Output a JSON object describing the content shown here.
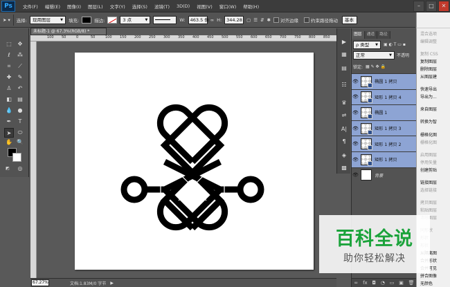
{
  "app": {
    "logo": "Ps"
  },
  "menu": [
    "文件(F)",
    "编辑(E)",
    "图像(I)",
    "图层(L)",
    "文字(Y)",
    "选择(S)",
    "滤镜(T)",
    "3D(D)",
    "视图(V)",
    "窗口(W)",
    "帮助(H)"
  ],
  "window_buttons": [
    "–",
    "□",
    "✕"
  ],
  "options": {
    "select_label": "选择:",
    "select_value": "现用图层",
    "fill_label": "填充:",
    "stroke_label": "描边:",
    "stroke_width": "3 点",
    "width_label": "W:",
    "width_value": "463.5 像",
    "height_label": "H:",
    "height_value": "344.28",
    "align_edges": "对齐边缘",
    "constrain": "约束路径拖动",
    "workspace": "基本"
  },
  "document": {
    "tab_title": "未标题-1 @ 67.3%(RGB/8) *",
    "ruler_ticks": [
      "100",
      "50",
      "0",
      "50",
      "100",
      "150",
      "200",
      "250",
      "300",
      "350",
      "400",
      "450",
      "500",
      "550",
      "600",
      "650",
      "700",
      "750",
      "800",
      "850"
    ]
  },
  "status": {
    "zoom": "67.27%",
    "doc_info": "文档:1.83M/0 字节"
  },
  "layers_panel": {
    "tabs": [
      "图层",
      "通道",
      "路径"
    ],
    "filter_label": "ρ 类型",
    "blend_mode": "正常",
    "opacity_label": "不透明",
    "lock_label": "锁定:",
    "layers": [
      {
        "name": "椭圆 1 拷贝",
        "selected": true
      },
      {
        "name": "矩形 1 拷贝 4",
        "selected": true
      },
      {
        "name": "椭圆 1",
        "selected": true
      },
      {
        "name": "矩形 1 拷贝 3",
        "selected": true
      },
      {
        "name": "矩形 1 拷贝 2",
        "selected": true
      },
      {
        "name": "矩形 1 拷贝",
        "selected": true
      },
      {
        "name": "背景",
        "selected": false
      }
    ],
    "footer_icons": [
      "∞",
      "fx",
      "◘",
      "◔",
      "▭",
      "▣",
      "🗑"
    ]
  },
  "context_menu": {
    "items": [
      {
        "label": "混合选项",
        "disabled": true
      },
      {
        "label": "编辑调整",
        "disabled": true
      },
      {
        "label": "复制 CSS",
        "disabled": true
      },
      {
        "label": "复制图层",
        "disabled": false
      },
      {
        "label": "删除图层",
        "disabled": false
      },
      {
        "label": "从图层建",
        "disabled": false
      },
      {
        "label": "快速导出",
        "disabled": false
      },
      {
        "label": "导出为...",
        "disabled": false
      },
      {
        "label": "来自图层",
        "disabled": false
      },
      {
        "label": "转换为智",
        "disabled": false
      },
      {
        "label": "栅格化图",
        "disabled": false
      },
      {
        "label": "栅格化图",
        "disabled": true
      },
      {
        "label": "启用图层",
        "disabled": true
      },
      {
        "label": "停用矢量",
        "disabled": true
      },
      {
        "label": "创建剪贴",
        "disabled": false
      },
      {
        "label": "链接图层",
        "disabled": false
      },
      {
        "label": "选择链接",
        "disabled": true
      },
      {
        "label": "拷贝图层",
        "disabled": true
      },
      {
        "label": "粘贴图层",
        "disabled": true
      },
      {
        "label": "清除图层",
        "disabled": true
      },
      {
        "label": "同形状",
        "disabled": true
      },
      {
        "label": "形状",
        "disabled": true
      },
      {
        "label": "形状",
        "disabled": true
      },
      {
        "label": "从隔离图",
        "disabled": false
      },
      {
        "label": "合并形状",
        "disabled": false
      },
      {
        "label": "合并可见",
        "disabled": false
      },
      {
        "label": "拼合图像",
        "disabled": false
      },
      {
        "label": "无颜色",
        "disabled": false
      }
    ]
  },
  "watermark": {
    "title": "百科全说",
    "subtitle": "助你轻松解决"
  },
  "colors": {
    "ui_dark": "#535353",
    "selection": "#8da4d4",
    "watermark_green": "#1ba33b"
  }
}
